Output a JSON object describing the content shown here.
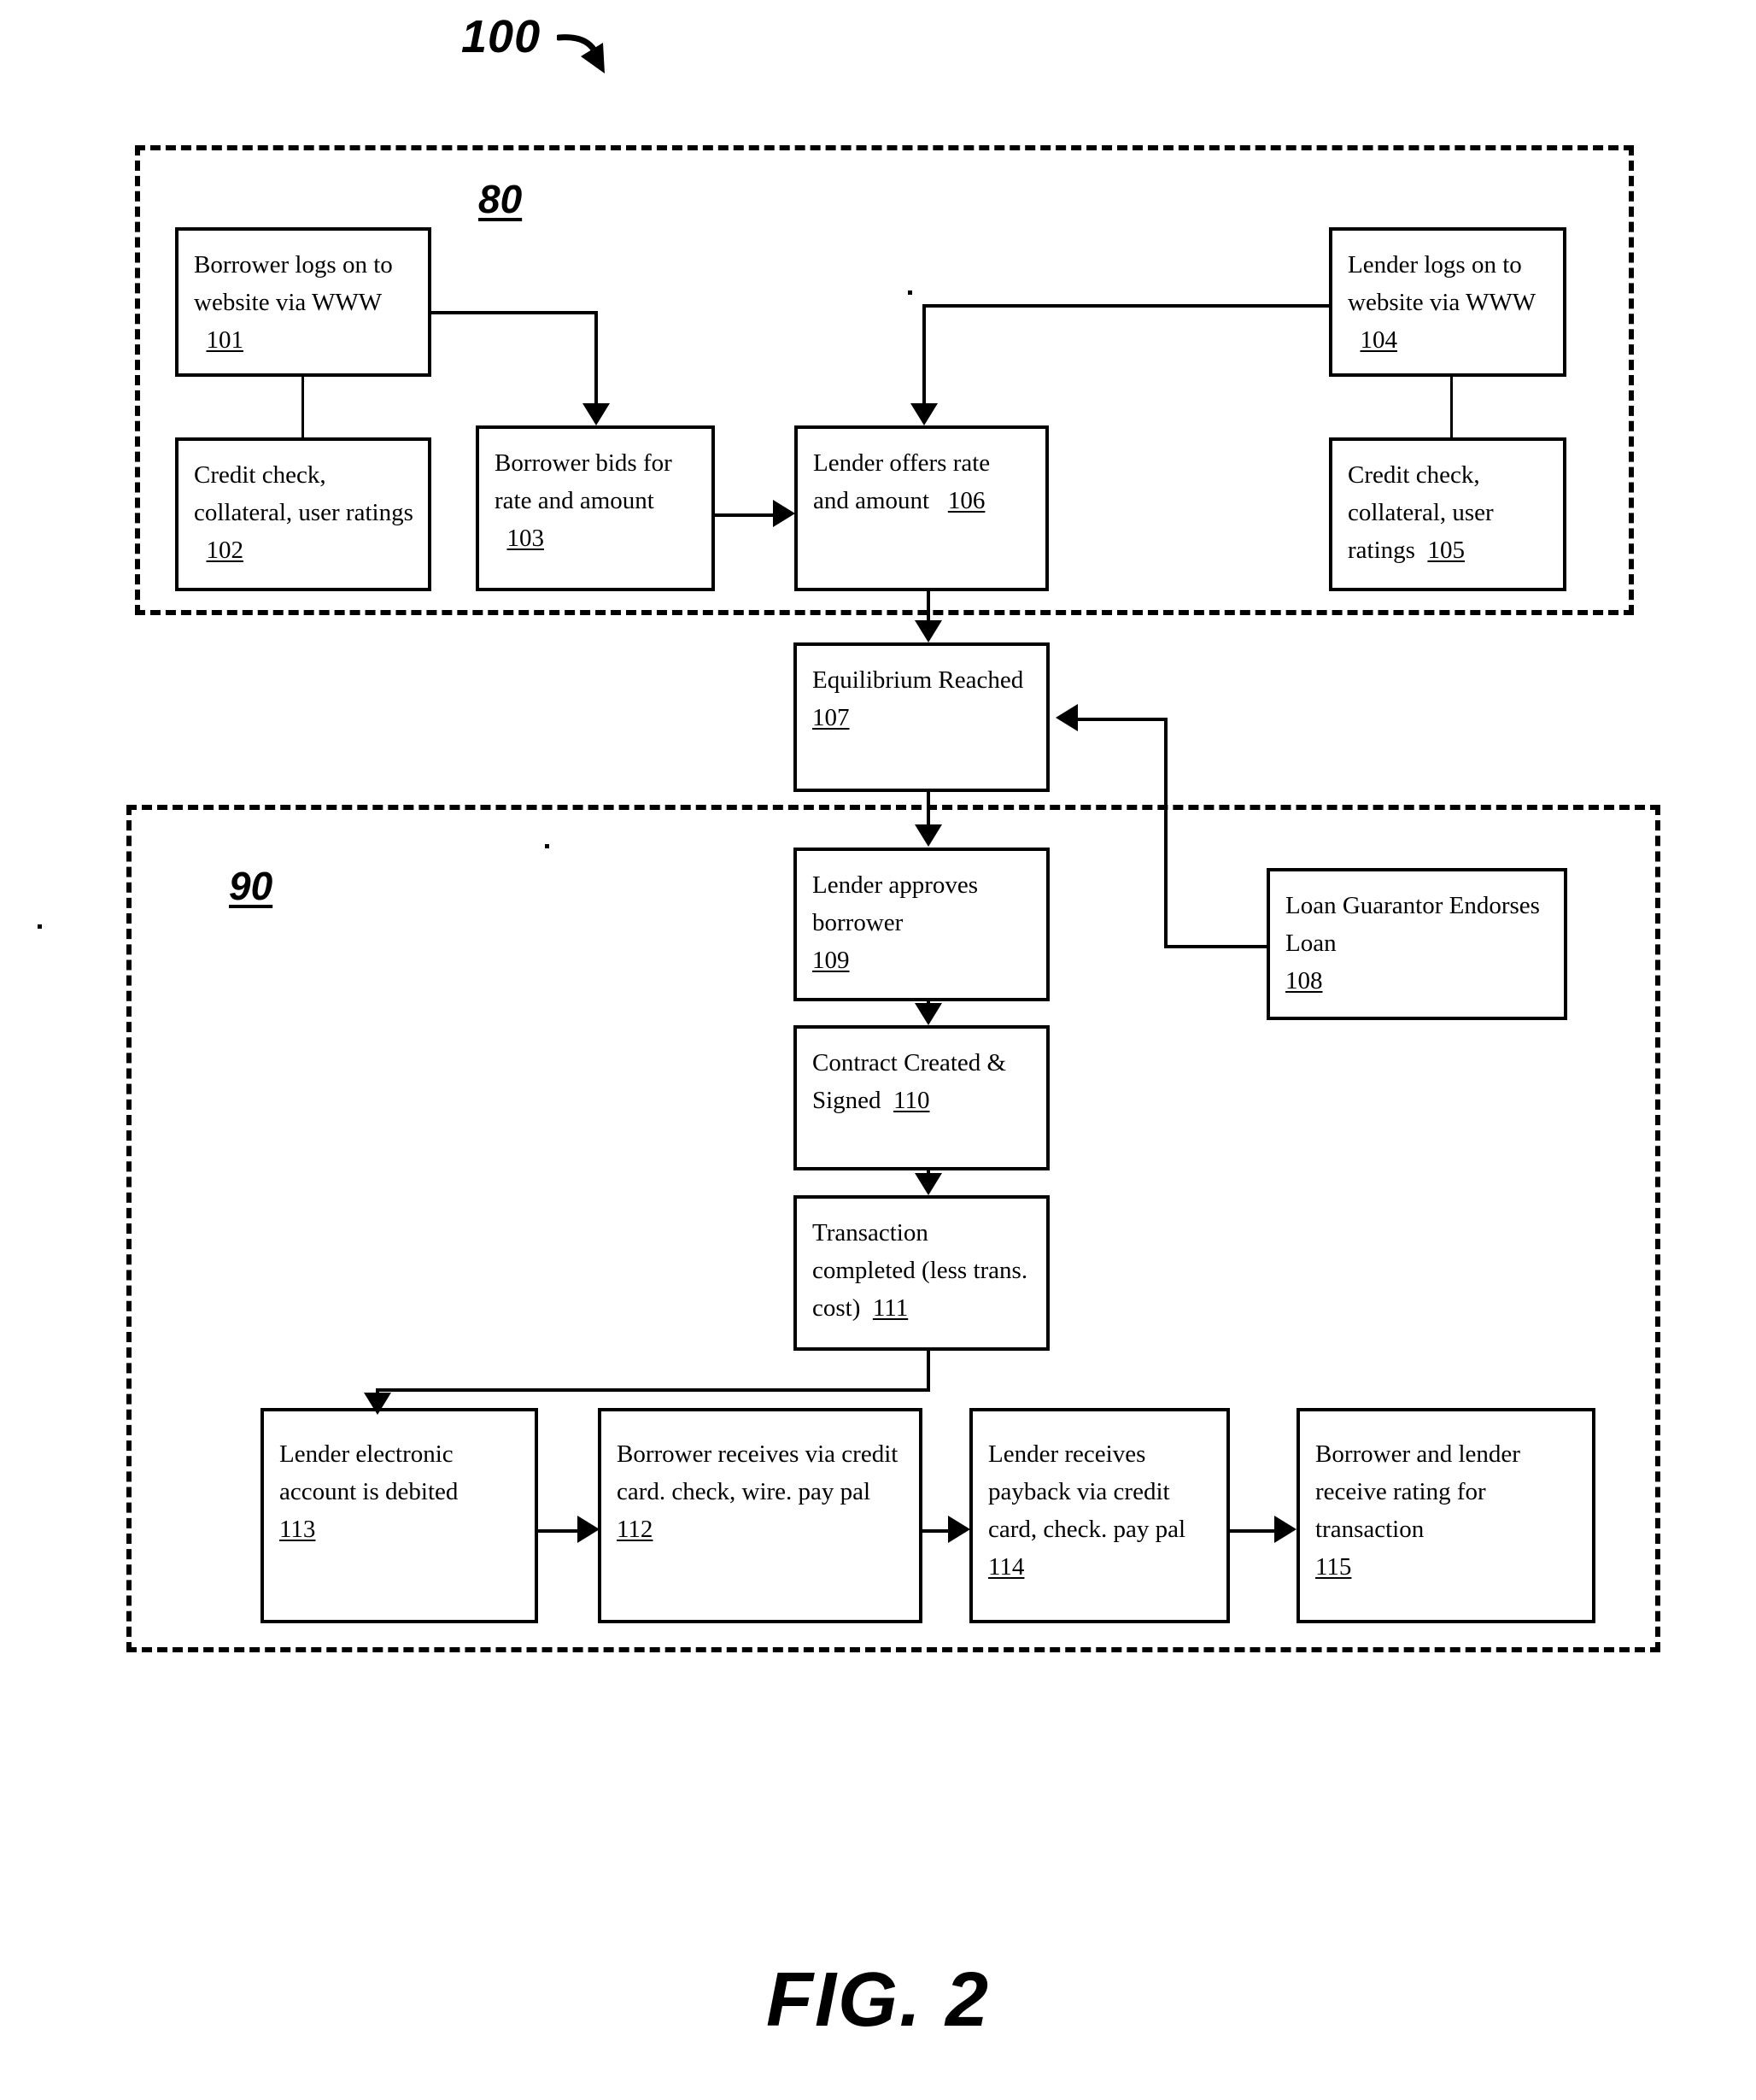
{
  "figure": {
    "caption": "FIG. 2",
    "system_ref": "100",
    "group_upper_ref": "80",
    "group_lower_ref": "90"
  },
  "nodes": [
    {
      "id": "n101",
      "text": "Borrower  logs on to website via WWW",
      "num": "101"
    },
    {
      "id": "n102",
      "text": "Credit check, collateral, user ratings",
      "num": "102"
    },
    {
      "id": "n103",
      "text": "Borrower bids for rate and amount",
      "num": "103"
    },
    {
      "id": "n106",
      "text": "Lender offers rate and amount",
      "num": "106"
    },
    {
      "id": "n104",
      "text": "Lender logs on to website via WWW",
      "num": "104"
    },
    {
      "id": "n105",
      "text": "Credit check, collateral, user ratings",
      "num": "105"
    },
    {
      "id": "n107",
      "text": "Equilibrium Reached",
      "num": "107"
    },
    {
      "id": "n109",
      "text": "Lender approves borrower",
      "num": "109"
    },
    {
      "id": "n108",
      "text": "Loan Guarantor Endorses Loan",
      "num": "108"
    },
    {
      "id": "n110",
      "text": "Contract Created &",
      "num": "110",
      "text2": "Signed"
    },
    {
      "id": "n111",
      "text": "Transaction completed (less trans. cost)",
      "num": "111"
    },
    {
      "id": "n113",
      "text": "Lender electronic account is debited",
      "num": "113"
    },
    {
      "id": "n112",
      "text": "Borrower receives via credit card. check,  wire. pay pal",
      "num": "112"
    },
    {
      "id": "n114",
      "text": "Lender receives payback via credit card, check. pay pal",
      "num": "114"
    },
    {
      "id": "n115",
      "text": "Borrower and lender receive rating for transaction",
      "num": "115"
    }
  ],
  "node_text": {
    "n101": "Borrower  logs on to website via WWW",
    "n101_num": "101",
    "n102": "Credit check, collateral, user ratings",
    "n102_num": "102",
    "n103": "Borrower bids for rate and amount",
    "n103_num": "103",
    "n106": "Lender offers rate and amount",
    "n106_num": "106",
    "n104": "Lender logs on to website via WWW",
    "n104_num": "104",
    "n105": "Credit check, collateral, user ratings",
    "n105_num": "105",
    "n107": "Equilibrium Reached",
    "n107_num": "107",
    "n109": "Lender approves borrower",
    "n109_num": "109",
    "n108": "Loan Guarantor Endorses Loan",
    "n108_num": "108",
    "n110a": "Contract Created &",
    "n110b": "Signed",
    "n110_num": "110",
    "n111": "Transaction completed (less trans. cost)",
    "n111_num": "111",
    "n113": "Lender electronic account is debited",
    "n113_num": "113",
    "n112": "Borrower receives via credit card. check,  wire. pay pal",
    "n112_num": "112",
    "n114": "Lender receives payback via credit card, check. pay pal",
    "n114_num": "114",
    "n115": "Borrower and lender receive rating for transaction",
    "n115_num": "115"
  },
  "colors": {
    "ink": "#000000",
    "paper": "#ffffff"
  }
}
